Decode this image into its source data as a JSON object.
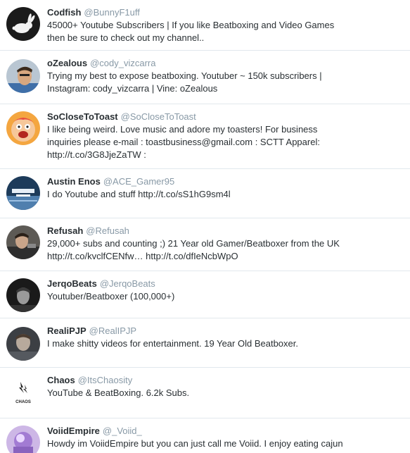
{
  "users": [
    {
      "name": "Codfish",
      "handle": "@BunnyF1uff",
      "bio": "45000+ Youtube Subscribers | If you like Beatboxing and Video Games\nthen be sure to check out my channel..",
      "avatar": "rabbit-icon"
    },
    {
      "name": "oZealous",
      "handle": "@cody_vizcarra",
      "bio": "Trying my best to expose beatboxing. Youtuber ~ 150k subscribers |\nInstagram: cody_vizcarra | Vine: oZealous",
      "avatar": "person-photo"
    },
    {
      "name": "SoCloseToToast",
      "handle": "@SoCloseToToast",
      "bio": "I like being weird. Love music and adore my toasters! For business\ninquiries please e-mail : toastbusiness@gmail.com : SCTT Apparel:\nhttp://t.co/3G8JjeZaTW :",
      "avatar": "cartoon-face"
    },
    {
      "name": "Austin Enos",
      "handle": "@ACE_Gamer95",
      "bio": "I do Youtube and stuff  http://t.co/sS1hG9sm4l",
      "avatar": "gaming-logo"
    },
    {
      "name": "Refusah",
      "handle": "@Refusah",
      "bio": "29,000+ subs and counting ;) 21 Year old Gamer/Beatboxer from the UK\nhttp://t.co/kvclfCENfw…  http://t.co/dfIeNcbWpO",
      "avatar": "person-photo"
    },
    {
      "name": "JerqoBeats",
      "handle": "@JerqoBeats",
      "bio": "Youtuber/Beatboxer (100,000+)",
      "avatar": "person-photo"
    },
    {
      "name": "RealiPJP",
      "handle": "@RealIPJP",
      "bio": "I make shitty videos for entertainment. 19 Year Old Beatboxer.",
      "avatar": "person-photo"
    },
    {
      "name": "Chaos",
      "handle": "@ItsChaosity",
      "bio": "YouTube & BeatBoxing. 6.2k Subs.",
      "avatar": "chaos-logo",
      "avatar_text": "CHAOS"
    },
    {
      "name": "VoiidEmpire",
      "handle": "@_Voiid_",
      "bio": "Howdy im VoiidEmpire but you can just call me Voiid. I enjoy eating cajun",
      "avatar": "abstract-art"
    }
  ]
}
